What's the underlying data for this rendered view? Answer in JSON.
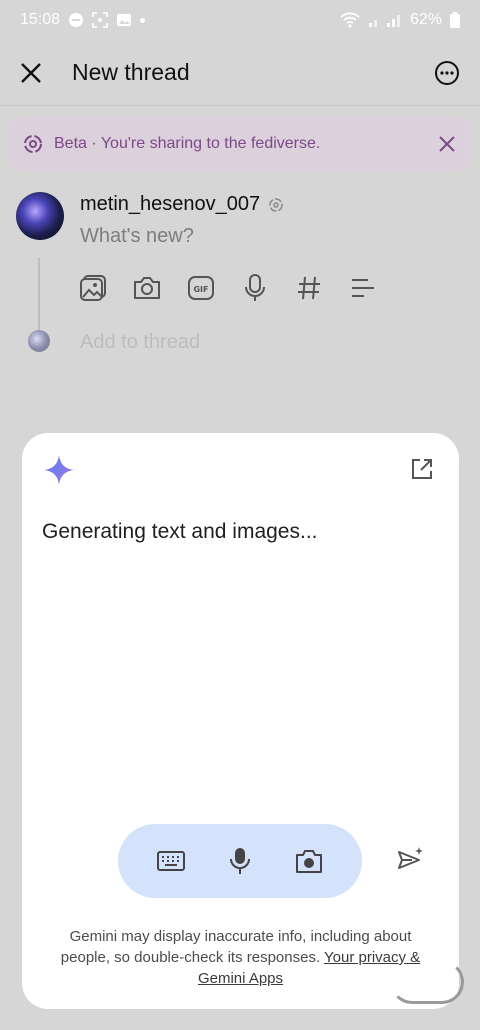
{
  "status_bar": {
    "time": "15:08",
    "battery": "62%"
  },
  "header": {
    "title": "New thread",
    "close_icon": "close-icon",
    "more_icon": "more-options-icon"
  },
  "banner": {
    "text": "Beta · You're sharing to the fediverse.",
    "icon": "fediverse-icon",
    "close_icon": "close-icon"
  },
  "composer": {
    "username": "metin_hesenov_007",
    "placeholder": "What's new?",
    "tools": [
      "gallery-icon",
      "camera-icon",
      "gif-icon",
      "microphone-icon",
      "hashtag-icon",
      "poll-icon"
    ],
    "add_to_thread": "Add to thread"
  },
  "gemini": {
    "status": "Generating text and images...",
    "disclaimer_text": "Gemini may display inaccurate info, including about people, so double-check its responses.",
    "disclaimer_link": "Your privacy & Gemini Apps",
    "colors": {
      "sheet": "#ffffff",
      "pill": "#d5e2fb",
      "sparkle_start": "#4f7ff0",
      "sparkle_end": "#a877e8"
    }
  },
  "colors": {
    "background": "#d6d6d6",
    "banner_bg": "#dcd0dc",
    "banner_text": "#7a4a86"
  }
}
